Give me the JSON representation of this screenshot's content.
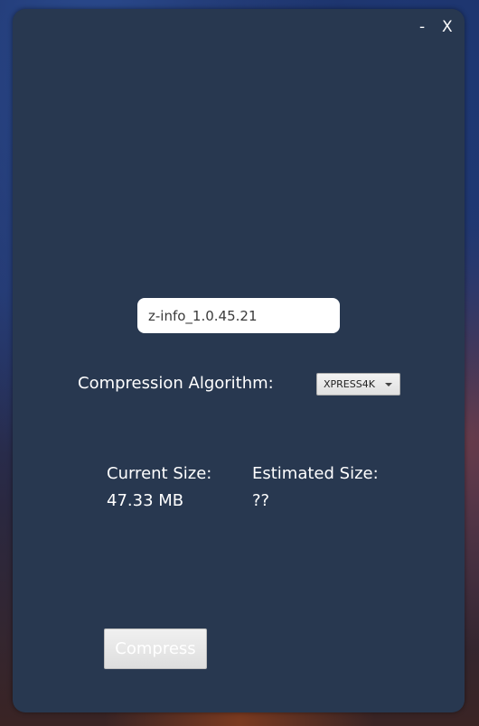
{
  "window": {
    "minimize_label": "-",
    "close_label": "X"
  },
  "name_field": {
    "value": "z-info_1.0.45.21"
  },
  "algorithm": {
    "label": "Compression Algorithm:",
    "selected": "XPRESS4K"
  },
  "sizes": {
    "current_label": "Current Size:",
    "current_value": "47.33 MB",
    "estimated_label": "Estimated Size:",
    "estimated_value": "??"
  },
  "actions": {
    "compress_label": "Compress"
  },
  "colors": {
    "panel_bg": "#283850",
    "text": "#ffffff"
  }
}
